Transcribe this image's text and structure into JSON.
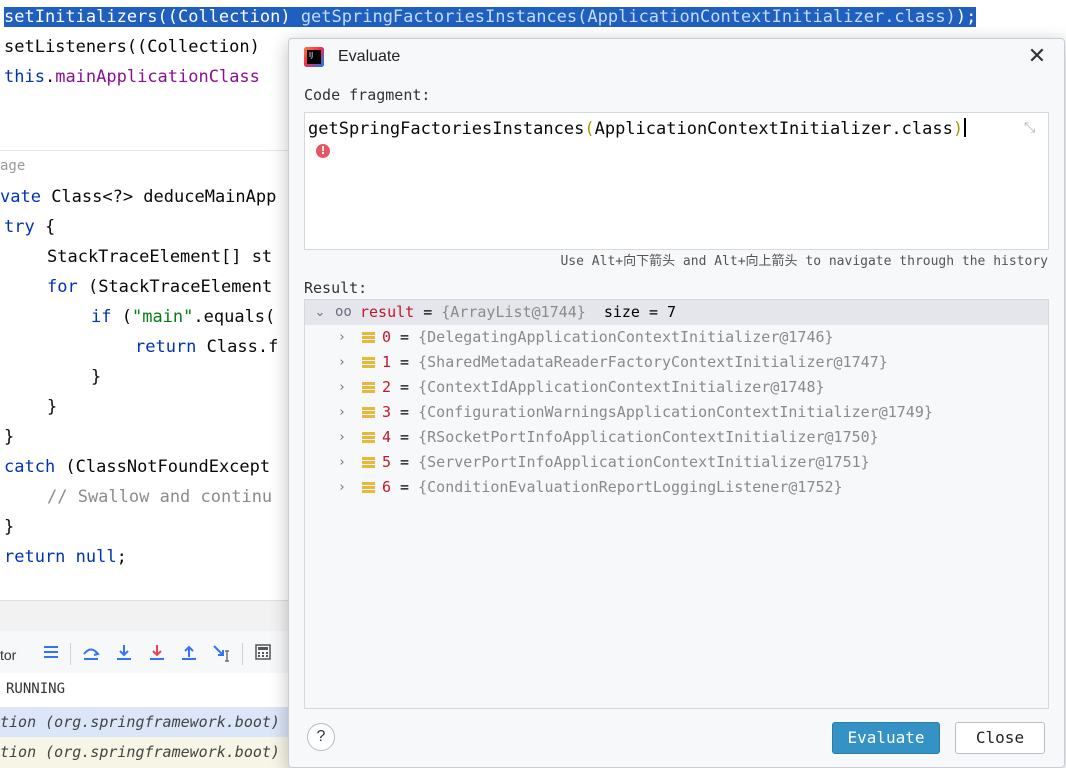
{
  "editor": {
    "line1_a": "setInitializers((Collection) ",
    "line1_b": "getSpringFactoriesInstances(ApplicationContextInitializer.class)",
    "line1_c": ");",
    "line2": "setListeners((Collection)",
    "line3_kw": "this",
    "line3_rest": ".",
    "line3_field": "mainApplicationClass",
    "usage_tag": "age",
    "line5_kw": "vate",
    "line5_rest": " Class<?> deduceMainApp",
    "line6_kw": "try",
    "line6_rest": " {",
    "line7": "StackTraceElement[] st",
    "line8_kw": "for",
    "line8_rest": " (StackTraceElement",
    "line9_kw": "if",
    "line9_str": "\"main\"",
    "line9_rest": ".equals(",
    "line10_kw": "return",
    "line10_rest": " Class.f",
    "line11": "}",
    "line12": "}",
    "line13": "}",
    "line14_kw": "catch",
    "line14_rest": " (ClassNotFoundExcept",
    "line15": "// Swallow and continu",
    "line16": "}",
    "line17_kw": "return",
    "line17_kw2": "null",
    "line17_rest": ";"
  },
  "debug": {
    "toolbar_label": "tor",
    "status": "RUNNING",
    "frames": [
      "tion (org.springframework.boot)",
      "tion (org.springframework.boot)"
    ]
  },
  "dialog": {
    "title": "Evaluate",
    "code_fragment_label": "Code fragment:",
    "code_fn": "getSpringFactoriesInstances",
    "code_arg": "ApplicationContextInitializer.class",
    "error_mark": "!",
    "hint": "Use Alt+向下箭头 and Alt+向上箭头 to navigate through the history",
    "result_label": "Result:",
    "result": {
      "name": "result",
      "eq": " = ",
      "value": "{ArrayList@1744}",
      "size": "  size = 7"
    },
    "items": [
      {
        "index": "0",
        "value": "{DelegatingApplicationContextInitializer@1746}"
      },
      {
        "index": "1",
        "value": "{SharedMetadataReaderFactoryContextInitializer@1747}"
      },
      {
        "index": "2",
        "value": "{ContextIdApplicationContextInitializer@1748}"
      },
      {
        "index": "3",
        "value": "{ConfigurationWarningsApplicationContextInitializer@1749}"
      },
      {
        "index": "4",
        "value": "{RSocketPortInfoApplicationContextInitializer@1750}"
      },
      {
        "index": "5",
        "value": "{ServerPortInfoApplicationContextInitializer@1751}"
      },
      {
        "index": "6",
        "value": "{ConditionEvaluationReportLoggingListener@1752}"
      }
    ],
    "help_label": "?",
    "evaluate_label": "Evaluate",
    "close_label": "Close"
  },
  "colors": {
    "selection": "#1f5fbf",
    "evaluate_button": "#3592c4",
    "keyword": "#0033b3",
    "field": "#871094"
  }
}
